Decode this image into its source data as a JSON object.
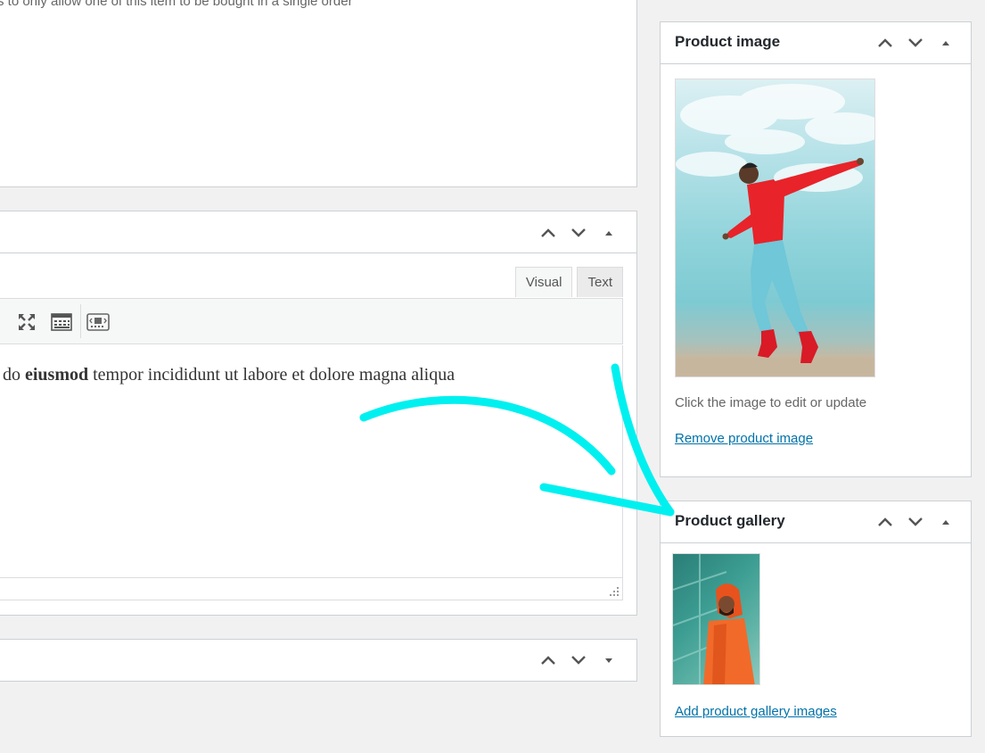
{
  "settings_box": {
    "note": "s to only allow one of this item to be bought in a single order"
  },
  "description_box": {
    "tabs": {
      "visual": "Visual",
      "text": "Text"
    },
    "toolbar_icons": [
      "fullscreen-icon",
      "toolbar-toggle-icon",
      "insert-block-icon"
    ],
    "editor": {
      "lead": "do ",
      "bold": "eiusmod",
      "tail": " tempor incididunt ut labore et dolore magna aliqua"
    }
  },
  "product_image": {
    "title": "Product image",
    "hint": "Click the image to edit or update",
    "remove_link": "Remove product image"
  },
  "product_gallery": {
    "title": "Product gallery",
    "add_link": "Add product gallery images"
  },
  "colors": {
    "accent_arrow": "#00f0f0",
    "link": "#0073aa",
    "page_bg": "#f1f1f1"
  }
}
